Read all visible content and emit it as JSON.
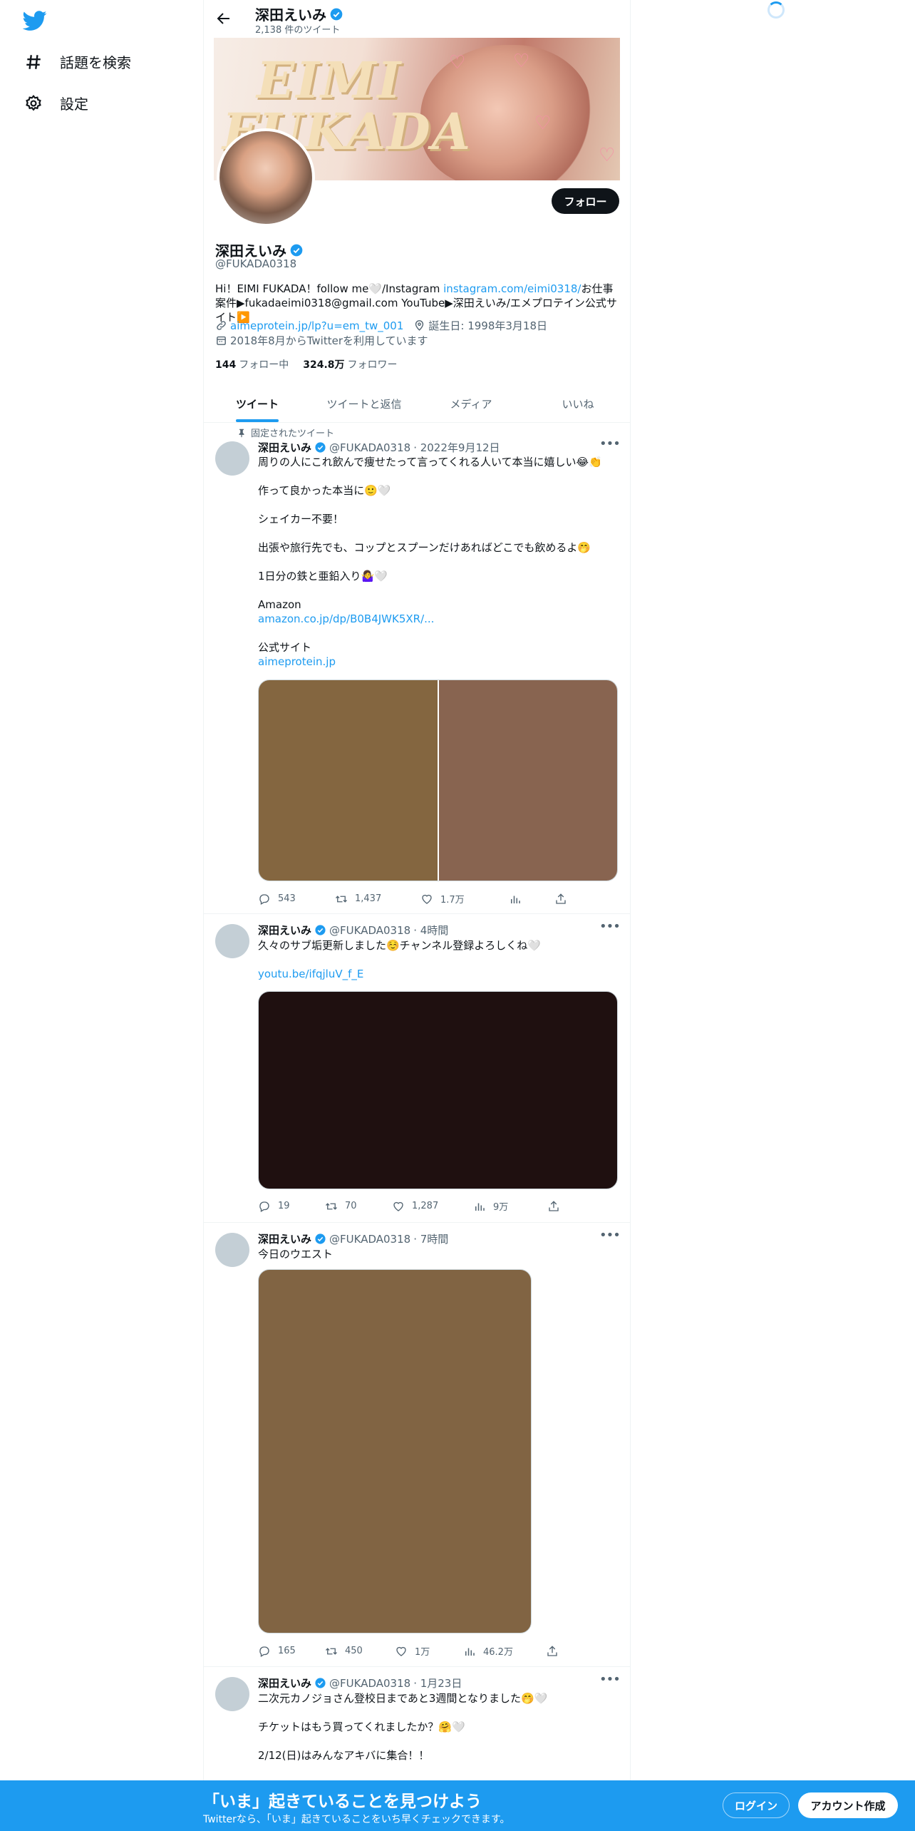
{
  "nav": {
    "explore_label": "話題を検索",
    "settings_label": "設定"
  },
  "header": {
    "name": "深田えいみ",
    "tweet_count": "2,138 件のツイート"
  },
  "profile": {
    "banner_text_1": "EIMI",
    "banner_text_2": "FUKADA",
    "follow_label": "フォロー",
    "name": "深田えいみ",
    "handle": "@FUKADA0318",
    "bio_part1": "Hi！EIMI FUKADA！follow me🤍/Instagram ",
    "bio_link": "instagram.com/eimi0318/",
    "bio_part2": "お仕事案件▶fukadaeimi0318@gmail.com YouTube▶深田えいみ/エメプロテイン公式サイト▶️",
    "website": "aimeprotein.jp/lp?u=em_tw_001",
    "birthday": "誕生日: 1998年3月18日",
    "joined": "2018年8月からTwitterを利用しています",
    "following_count": "144",
    "following_label": "フォロー中",
    "followers_count": "324.8万",
    "followers_label": "フォロワー"
  },
  "tabs": [
    "ツイート",
    "ツイートと返信",
    "メディア",
    "いいね"
  ],
  "tweets": [
    {
      "pinned_label": "固定されたツイート",
      "name": "深田えいみ",
      "handle": "@FUKADA0318",
      "time": "· 2022年9月12日",
      "lines": [
        "周りの人にこれ飲んで痩せたって言ってくれる人いて本当に嬉しい😂👏",
        "",
        "作って良かった本当に🙂🤍",
        "",
        "シェイカー不要！",
        "",
        "出張や旅行先でも、コップとスプーンだけあればどこでも飲めるよ🤭",
        "",
        "1日分の鉄と亜鉛入り🤷‍♀️🤍",
        "",
        "Amazon"
      ],
      "link1": "amazon.co.jp/dp/B0B4JWK5XR/...",
      "line_after": "公式サイト",
      "link2": "aimeprotein.jp",
      "media_colors": [
        "#846640",
        "#886450"
      ],
      "replies": "543",
      "retweets": "1,437",
      "likes": "1.7万",
      "views": ""
    },
    {
      "name": "深田えいみ",
      "handle": "@FUKADA0318",
      "time": "· 4時間",
      "text": "久々のサブ垢更新しました☺️チャンネル登録よろしくね🤍",
      "link": "youtu.be/ifqjluV_f_E",
      "media_color": "#1f1010",
      "replies": "19",
      "retweets": "70",
      "likes": "1,287",
      "views": "9万"
    },
    {
      "name": "深田えいみ",
      "handle": "@FUKADA0318",
      "time": "· 7時間",
      "text": "今日のウエスト",
      "media_color": "#816443",
      "replies": "165",
      "retweets": "450",
      "likes": "1万",
      "views": "46.2万"
    },
    {
      "name": "深田えいみ",
      "handle": "@FUKADA0318",
      "time": "· 1月23日",
      "lines": [
        "二次元カノジョさん登校日まであと3週間となりました🤭🤍",
        "",
        "チケットはもう買ってくれましたか？🤗🤍",
        "",
        "2/12(日)はみんなアキバに集合！！"
      ]
    }
  ],
  "bottom_bar": {
    "title": "「いま」起きていることを見つけよう",
    "subtitle": "Twitterなら、「いま」起きていることをいち早くチェックできます。",
    "login_label": "ログイン",
    "signup_label": "アカウント作成"
  },
  "colors": {
    "accent": "#1d9bf0",
    "text": "#0f1419",
    "muted": "#536471"
  },
  "icons": [
    "twitter-logo-icon",
    "hashtag-icon",
    "gear-icon",
    "back-arrow-icon",
    "verified-icon",
    "link-icon",
    "location-icon",
    "calendar-icon",
    "pin-icon",
    "reply-icon",
    "retweet-icon",
    "like-icon",
    "views-icon",
    "share-icon",
    "more-icon",
    "loading-spinner-icon"
  ]
}
